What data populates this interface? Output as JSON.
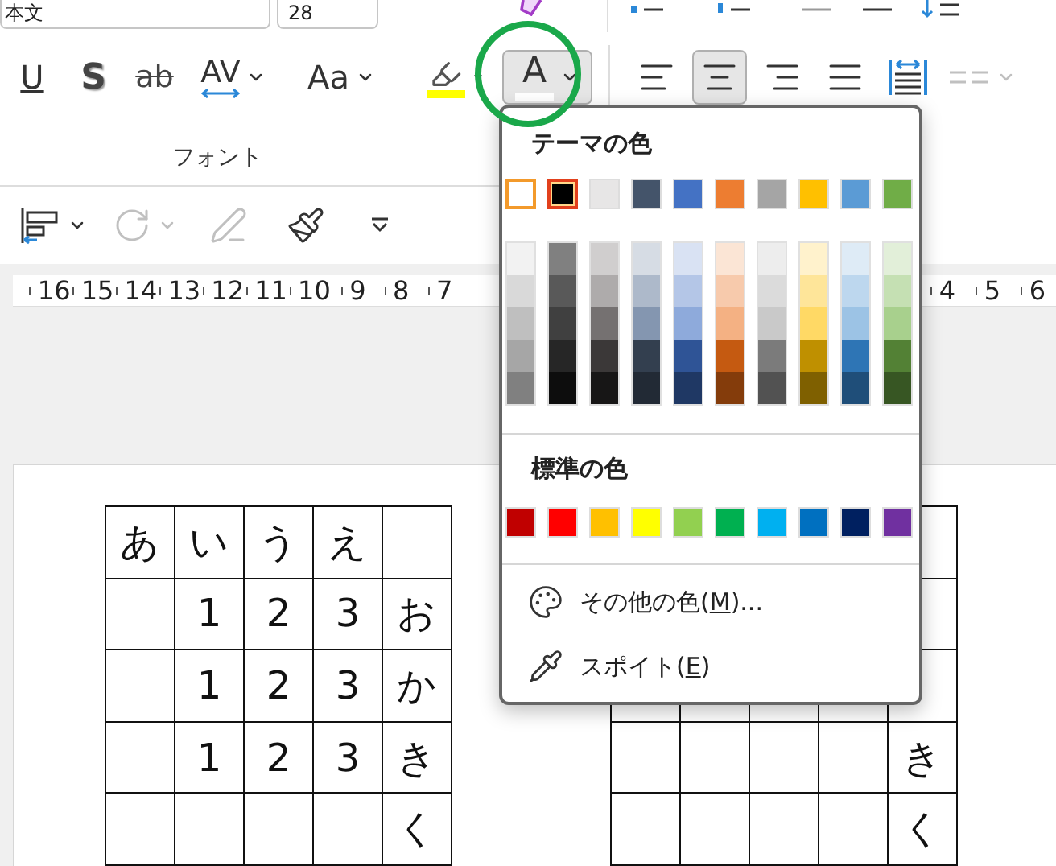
{
  "ribbon": {
    "font_name": {
      "value": "本文"
    },
    "font_size": {
      "value": "28"
    },
    "format_buttons": [
      {
        "kind": "underline",
        "label": "U",
        "selected": false
      },
      {
        "kind": "shadow",
        "label": "S",
        "selected": false
      },
      {
        "kind": "strikethrough",
        "label": "ab",
        "selected": false
      },
      {
        "kind": "spacing",
        "label": "AV",
        "selected": false
      },
      {
        "kind": "case",
        "label": "Aa",
        "selected": false
      },
      {
        "kind": "highlight",
        "color": "#ffff00",
        "selected": false
      },
      {
        "kind": "font_color",
        "label": "A",
        "color": "#ffffff",
        "selected": true
      }
    ],
    "paragraph_buttons": [
      {
        "kind": "align_left",
        "selected": false,
        "disabled": false
      },
      {
        "kind": "align_center",
        "selected": true,
        "disabled": false
      },
      {
        "kind": "align_right",
        "selected": false,
        "disabled": false
      },
      {
        "kind": "justify",
        "selected": false,
        "disabled": false
      },
      {
        "kind": "distribute",
        "selected": false,
        "disabled": false
      },
      {
        "kind": "columns",
        "selected": false,
        "disabled": true
      }
    ],
    "group_label": "フォント",
    "drawing_tools": [
      {
        "kind": "align",
        "disabled": false
      },
      {
        "kind": "rotate",
        "disabled": true
      },
      {
        "kind": "edit_shape",
        "disabled": true
      },
      {
        "kind": "format_painter",
        "disabled": false
      },
      {
        "kind": "more",
        "disabled": false
      }
    ]
  },
  "ruler": {
    "left_numbers": [
      "16",
      "15",
      "14",
      "13",
      "12",
      "11",
      "10",
      "9",
      "8",
      "7"
    ],
    "right_numbers": [
      "4",
      "5",
      "6"
    ]
  },
  "document": {
    "tables": [
      {
        "rows": [
          [
            "あ",
            "い",
            "う",
            "え",
            null
          ],
          [
            null,
            "1",
            "2",
            "3",
            "お"
          ],
          [
            null,
            "1",
            "2",
            "3",
            "か"
          ],
          [
            null,
            "1",
            "2",
            "3",
            "き"
          ],
          [
            null,
            null,
            null,
            null,
            "く"
          ]
        ]
      },
      {
        "rows": [
          [
            null,
            null,
            null,
            null,
            null
          ],
          [
            null,
            null,
            null,
            null,
            null
          ],
          [
            null,
            null,
            null,
            null,
            null
          ],
          [
            null,
            null,
            null,
            null,
            "き"
          ],
          [
            null,
            null,
            null,
            null,
            "く"
          ]
        ]
      }
    ]
  },
  "color_menu": {
    "theme_title": "テーマの色",
    "theme_colors": [
      {
        "color": "#ffffff",
        "selected": false,
        "hovered": true
      },
      {
        "color": "#000000",
        "selected": true,
        "hovered": false
      },
      {
        "color": "#e7e6e6",
        "selected": false,
        "hovered": false
      },
      {
        "color": "#44546a",
        "selected": false,
        "hovered": false
      },
      {
        "color": "#4472c4",
        "selected": false,
        "hovered": false
      },
      {
        "color": "#ed7d31",
        "selected": false,
        "hovered": false
      },
      {
        "color": "#a5a5a5",
        "selected": false,
        "hovered": false
      },
      {
        "color": "#ffc000",
        "selected": false,
        "hovered": false
      },
      {
        "color": "#5b9bd5",
        "selected": false,
        "hovered": false
      },
      {
        "color": "#70ad47",
        "selected": false,
        "hovered": false
      }
    ],
    "shade_columns": [
      {
        "shades": [
          {
            "color": "#f2f2f2"
          },
          {
            "color": "#d9d9d9"
          },
          {
            "color": "#bfbfbf"
          },
          {
            "color": "#a6a6a6"
          },
          {
            "color": "#808080"
          }
        ]
      },
      {
        "shades": [
          {
            "color": "#808080"
          },
          {
            "color": "#595959"
          },
          {
            "color": "#404040"
          },
          {
            "color": "#262626"
          },
          {
            "color": "#0d0d0d"
          }
        ]
      },
      {
        "shades": [
          {
            "color": "#d0cece"
          },
          {
            "color": "#aeabab"
          },
          {
            "color": "#757171"
          },
          {
            "color": "#3b3838"
          },
          {
            "color": "#171616"
          }
        ]
      },
      {
        "shades": [
          {
            "color": "#d6dce4"
          },
          {
            "color": "#adb9ca"
          },
          {
            "color": "#8496b0"
          },
          {
            "color": "#333f4f"
          },
          {
            "color": "#222a35"
          }
        ]
      },
      {
        "shades": [
          {
            "color": "#d9e2f3"
          },
          {
            "color": "#b4c6e7"
          },
          {
            "color": "#8eaadb"
          },
          {
            "color": "#2f5496"
          },
          {
            "color": "#1f3864"
          }
        ]
      },
      {
        "shades": [
          {
            "color": "#fbe5d5"
          },
          {
            "color": "#f7caac"
          },
          {
            "color": "#f4b183"
          },
          {
            "color": "#c55a11"
          },
          {
            "color": "#843c0b"
          }
        ]
      },
      {
        "shades": [
          {
            "color": "#ededed"
          },
          {
            "color": "#dbdbdb"
          },
          {
            "color": "#c9c9c9"
          },
          {
            "color": "#7b7b7b"
          },
          {
            "color": "#525252"
          }
        ]
      },
      {
        "shades": [
          {
            "color": "#fff2cc"
          },
          {
            "color": "#fee599"
          },
          {
            "color": "#ffd965"
          },
          {
            "color": "#bf9000"
          },
          {
            "color": "#7f6000"
          }
        ]
      },
      {
        "shades": [
          {
            "color": "#deebf6"
          },
          {
            "color": "#bdd7ee"
          },
          {
            "color": "#9cc3e5"
          },
          {
            "color": "#2e75b5"
          },
          {
            "color": "#1f4e79"
          }
        ]
      },
      {
        "shades": [
          {
            "color": "#e2efd9"
          },
          {
            "color": "#c5e0b3"
          },
          {
            "color": "#a8d08d"
          },
          {
            "color": "#538135"
          },
          {
            "color": "#375623"
          }
        ]
      }
    ],
    "standard_title": "標準の色",
    "standard_colors": [
      {
        "color": "#c00000"
      },
      {
        "color": "#ff0000"
      },
      {
        "color": "#ffc000"
      },
      {
        "color": "#ffff00"
      },
      {
        "color": "#92d050"
      },
      {
        "color": "#00b050"
      },
      {
        "color": "#00b0f0"
      },
      {
        "color": "#0070c0"
      },
      {
        "color": "#002060"
      },
      {
        "color": "#7030a0"
      }
    ],
    "items": [
      {
        "kind": "more_colors",
        "before": "その他の色(",
        "key": "M",
        "after": ")..."
      },
      {
        "kind": "eyedropper",
        "before": "スポイト(",
        "key": "E",
        "after": ")"
      }
    ]
  }
}
